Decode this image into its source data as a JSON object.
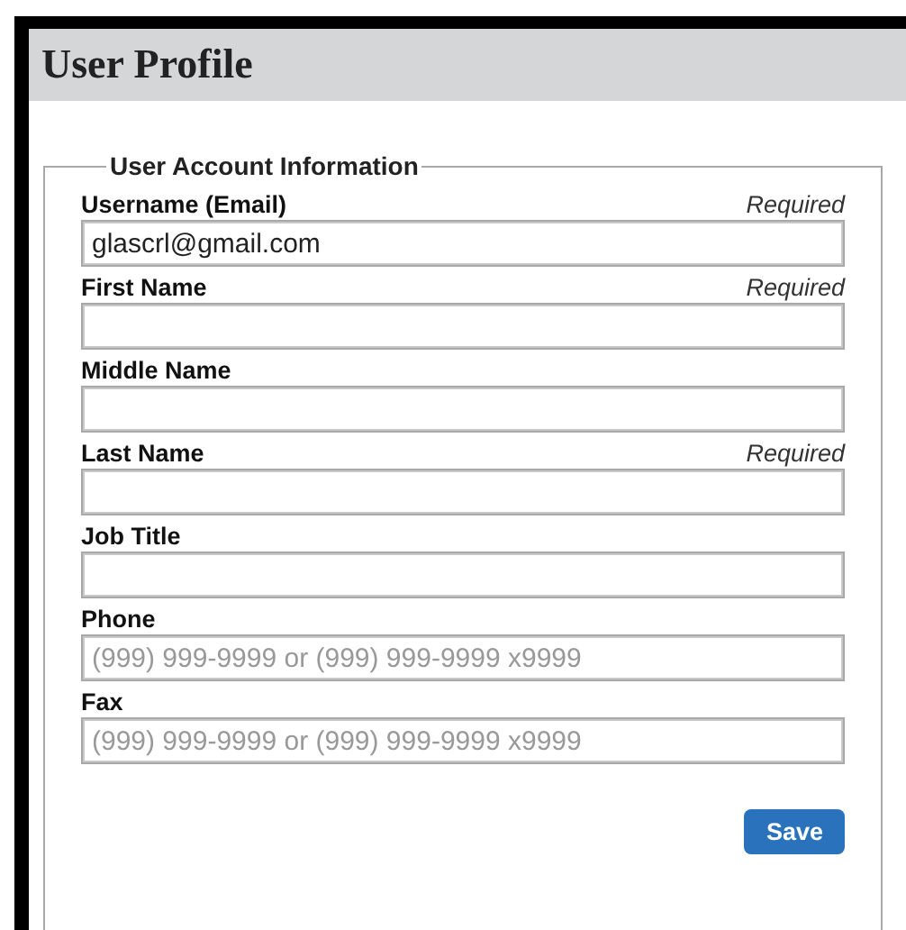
{
  "page": {
    "title": "User Profile"
  },
  "section": {
    "legend": "User Account Information",
    "fields": [
      {
        "label": "Username (Email)",
        "note": "Required",
        "value": "glascrl@gmail.com"
      },
      {
        "label": "First Name",
        "note": "Required"
      },
      {
        "label": "Middle Name"
      },
      {
        "label": "Last Name",
        "note": "Required"
      },
      {
        "label": "Job Title"
      },
      {
        "label": "Phone",
        "placeholder": "(999) 999-9999 or (999) 999-9999 x9999"
      },
      {
        "label": "Fax",
        "placeholder": "(999) 999-9999 or (999) 999-9999 x9999"
      }
    ],
    "buttons": [
      "Save"
    ]
  }
}
